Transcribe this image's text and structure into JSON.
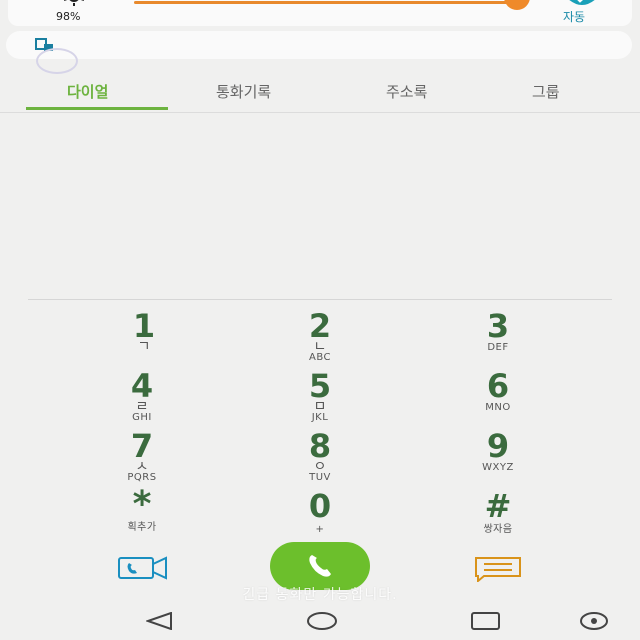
{
  "status": {
    "brightness_percent": "98%",
    "brightness_level": 0.98,
    "auto_label": "자동",
    "accent_color": "#e8892c"
  },
  "tabs": [
    {
      "label": "다이얼",
      "active": true
    },
    {
      "label": "통화기록",
      "active": false
    },
    {
      "label": "주소록",
      "active": false
    },
    {
      "label": "그룹",
      "active": false
    }
  ],
  "keypad": [
    {
      "num": "1",
      "sym": "ㄱ",
      "letters": ""
    },
    {
      "num": "2",
      "sym": "ㄴ",
      "letters": "ABC"
    },
    {
      "num": "3",
      "sym": "",
      "letters": "DEF"
    },
    {
      "num": "4",
      "sym": "ㄹ",
      "letters": "GHI"
    },
    {
      "num": "5",
      "sym": "ㅁ",
      "letters": "JKL"
    },
    {
      "num": "6",
      "sym": "",
      "letters": "MNO"
    },
    {
      "num": "7",
      "sym": "ㅅ",
      "letters": "PQRS"
    },
    {
      "num": "8",
      "sym": "ㅇ",
      "letters": "TUV"
    },
    {
      "num": "9",
      "sym": "",
      "letters": "WXYZ"
    },
    {
      "num": "*",
      "sym": "",
      "letters": "획추가"
    },
    {
      "num": "0",
      "sym": "",
      "letters": "+"
    },
    {
      "num": "#",
      "sym": "",
      "letters": "쌍자음"
    }
  ],
  "actions": {
    "video_icon": "video-call-icon",
    "call_icon": "phone-icon",
    "message_icon": "message-icon",
    "call_color": "#6cbf2c"
  },
  "overlay_text": "긴급 통화만 가능합니다.",
  "navbar": [
    "back-icon",
    "home-icon",
    "recents-icon",
    "sim-icon"
  ]
}
